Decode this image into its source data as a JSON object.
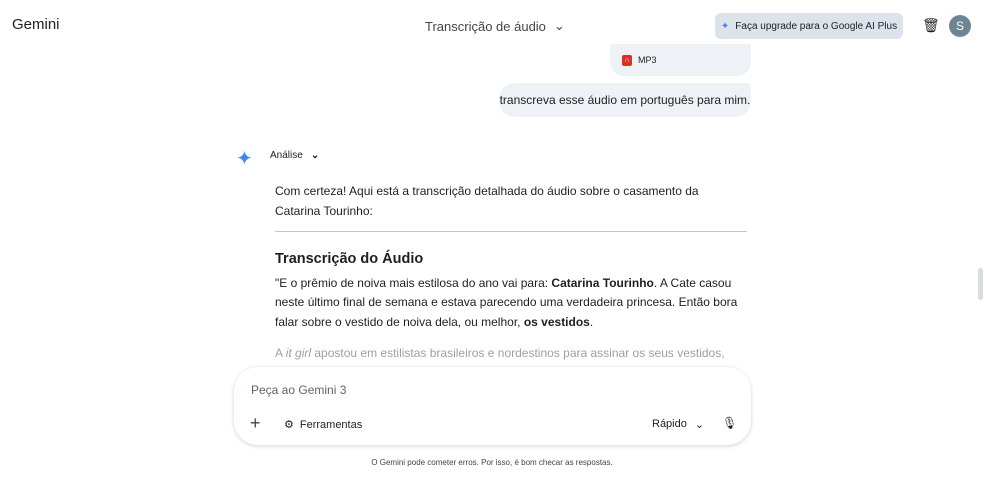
{
  "header": {
    "logo": "Gemini",
    "title": "Transcrição de áudio",
    "upgrade": "Faça upgrade para o Google AI Plus",
    "avatar": "S"
  },
  "chat": {
    "file_type": "MP3",
    "user_message": "transcreva esse áudio em português para mim.",
    "thinking_label": "Análise",
    "intro": "Com certeza! Aqui está a transcrição detalhada do áudio sobre o casamento da Catarina Tourinho:",
    "heading": "Transcrição do Áudio",
    "p1a": "\"E o prêmio de noiva mais estilosa do ano vai para: ",
    "p1b": "Catarina Tourinho",
    "p1c": ". A Cate casou neste último final de semana e estava parecendo uma verdadeira princesa. Então bora falar sobre o vestido de noiva dela, ou melhor, ",
    "p1d": "os vestidos",
    "p1e": ".",
    "p2a": "A ",
    "p2b": "it girl",
    "p2c": " apostou em estilistas brasileiros e nordestinos para assinar os seus vestidos, honrando"
  },
  "composer": {
    "placeholder": "Peça ao Gemini 3",
    "tools": "Ferramentas",
    "mode": "Rápido"
  },
  "disclaimer": "O Gemini pode cometer erros. Por isso, é bom checar as respostas."
}
